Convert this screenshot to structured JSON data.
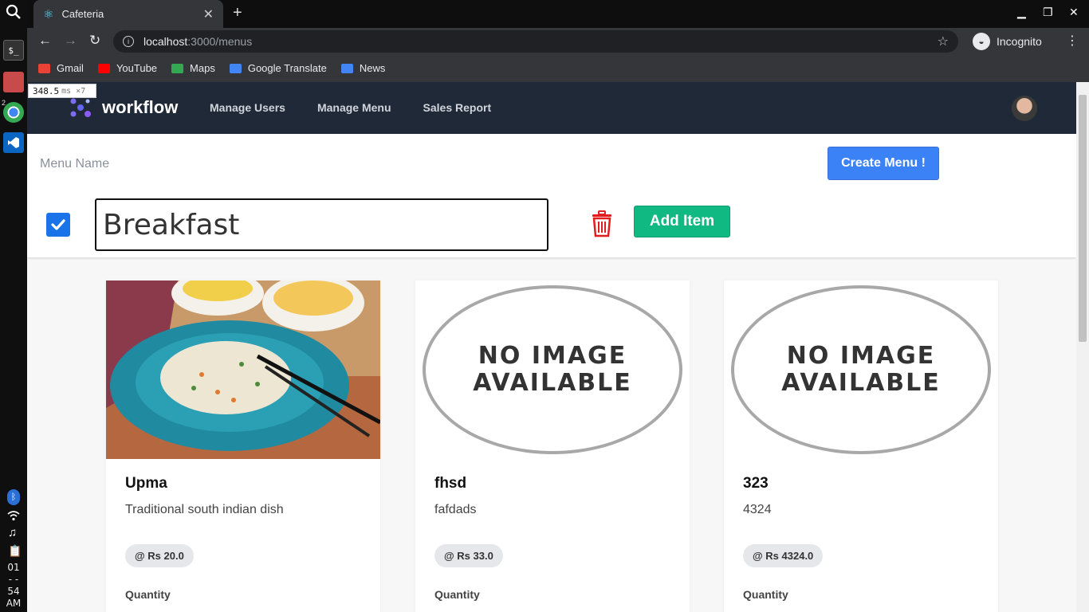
{
  "os": {
    "time_lines": [
      "01",
      "- -",
      "54",
      "AM"
    ],
    "workspace_number": "2"
  },
  "browser": {
    "tab_title": "Cafeteria",
    "url_host": "localhost",
    "url_path": ":3000/menus",
    "incognito_label": "Incognito",
    "bookmarks": [
      {
        "label": "Gmail",
        "color": "#ea4335"
      },
      {
        "label": "YouTube",
        "color": "#ff0000"
      },
      {
        "label": "Maps",
        "color": "#34a853"
      },
      {
        "label": "Google Translate",
        "color": "#4285f4"
      },
      {
        "label": "News",
        "color": "#4285f4"
      }
    ]
  },
  "timing_overlay": {
    "value": "348.5",
    "unit": "ms ×7"
  },
  "app": {
    "brand": "workflow",
    "nav": [
      "Manage Users",
      "Manage Menu",
      "Sales Report"
    ]
  },
  "menu_form": {
    "name_label": "Menu Name",
    "create_button": "Create Menu !",
    "menu_name_value": "Breakfast",
    "menu_checked": true,
    "add_item_button": "Add Item"
  },
  "items": [
    {
      "name": "Upma",
      "description": "Traditional south indian dish",
      "price": "@ Rs 20.0",
      "quantity_label": "Quantity",
      "has_image": true
    },
    {
      "name": "fhsd",
      "description": "fafdads",
      "price": "@ Rs 33.0",
      "quantity_label": "Quantity",
      "has_image": false,
      "placeholder_lines": [
        "NO IMAGE",
        "AVAILABLE"
      ]
    },
    {
      "name": "323",
      "description": "4324",
      "price": "@ Rs 4324.0",
      "quantity_label": "Quantity",
      "has_image": false,
      "placeholder_lines": [
        "NO IMAGE",
        "AVAILABLE"
      ]
    }
  ],
  "colors": {
    "navbar": "#1f2937",
    "create_button": "#3b82f6",
    "add_item_button": "#10b981",
    "trash": "#e11d1d"
  }
}
